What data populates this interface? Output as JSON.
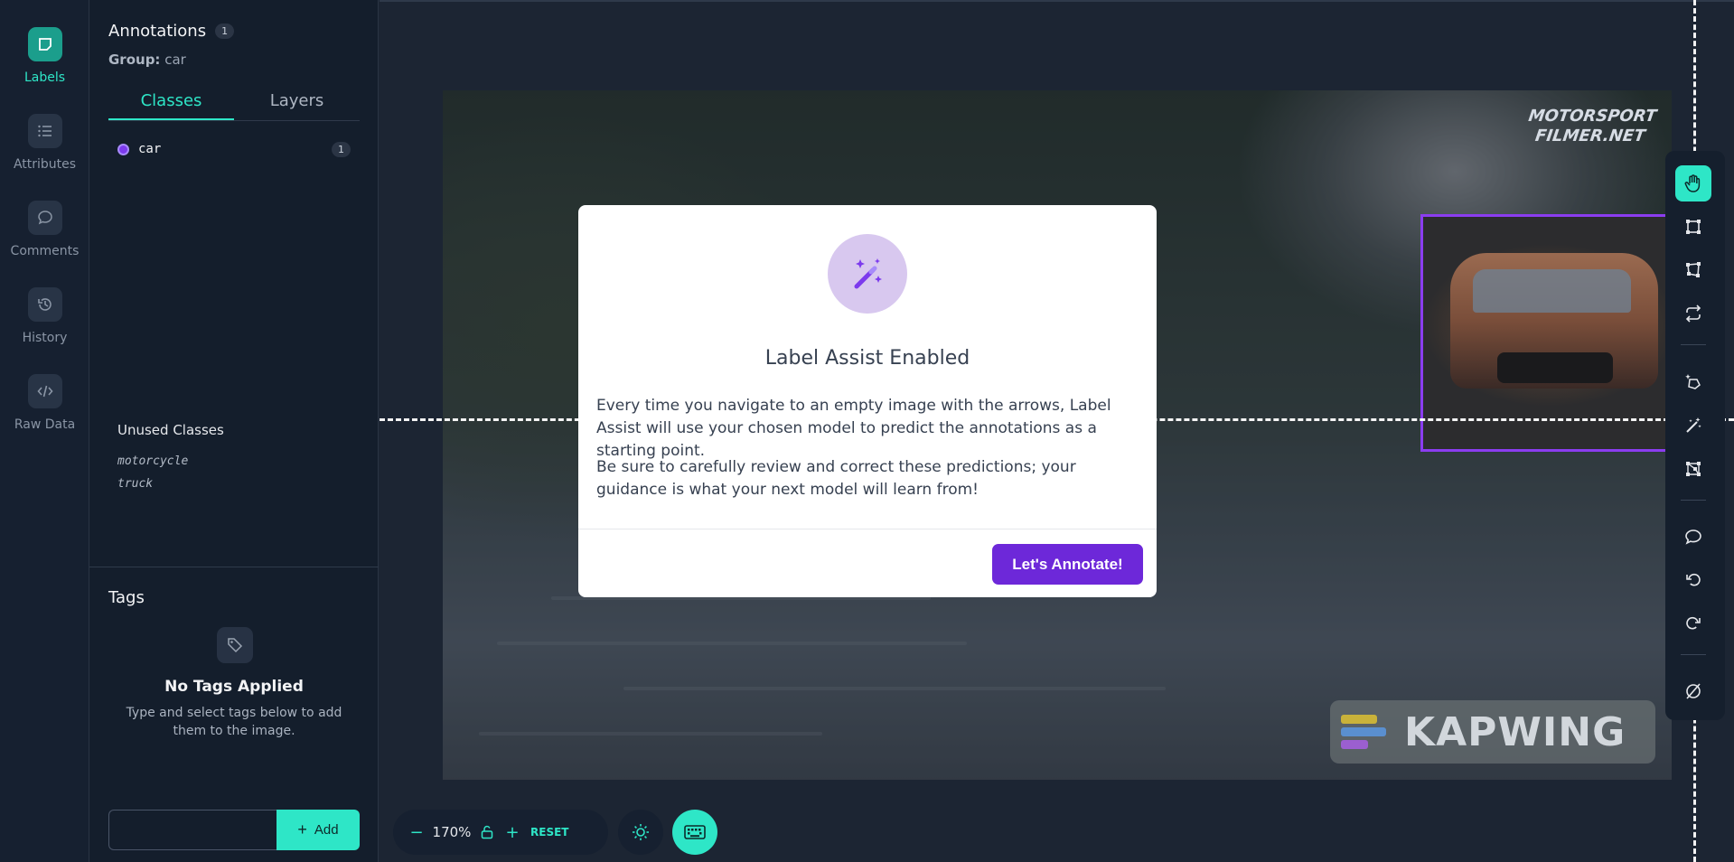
{
  "rail": {
    "items": [
      {
        "label": "Labels",
        "icon": "label-icon",
        "active": true
      },
      {
        "label": "Attributes",
        "icon": "list-icon"
      },
      {
        "label": "Comments",
        "icon": "comment-icon"
      },
      {
        "label": "History",
        "icon": "history-icon"
      },
      {
        "label": "Raw Data",
        "icon": "code-icon"
      }
    ]
  },
  "panel": {
    "title": "Annotations",
    "title_count": "1",
    "group_label": "Group:",
    "group_value": "car",
    "tabs": [
      {
        "label": "Classes",
        "active": true
      },
      {
        "label": "Layers"
      }
    ],
    "classes": [
      {
        "name": "car",
        "count": "1",
        "color": "#7c3aed"
      }
    ],
    "unused_title": "Unused Classes",
    "unused_classes": [
      "motorcycle",
      "truck"
    ]
  },
  "tags": {
    "title": "Tags",
    "empty_title": "No Tags Applied",
    "empty_sub": "Type and select tags below to add them to the image.",
    "input_value": "",
    "add_label": "Add"
  },
  "canvas": {
    "watermark_top": "MOTORSPORT FILMER.NET",
    "watermark_bottom": "KAPWING",
    "bbox_color": "#8b3df0"
  },
  "zoom": {
    "value": "170%",
    "reset_label": "RESET"
  },
  "modal": {
    "title": "Label Assist Enabled",
    "p1": "Every time you navigate to an empty image with the arrows, Label Assist will use your chosen model to predict the annotations as a starting point.",
    "p2": "Be sure to carefully review and correct these predictions; your guidance is what your next model will learn from!",
    "button": "Let's Annotate!"
  },
  "toolbar": {
    "tools": [
      "hand-icon",
      "bounding-box-icon",
      "polygon-icon",
      "convert-icon",
      "smart-select-icon",
      "magic-wand-icon",
      "keypoint-icon",
      "comment-icon",
      "undo-icon",
      "redo-icon",
      "hide-icon"
    ]
  },
  "colors": {
    "accent": "#2ee6c7",
    "primary": "#6d28d9",
    "background": "#1c2533"
  }
}
